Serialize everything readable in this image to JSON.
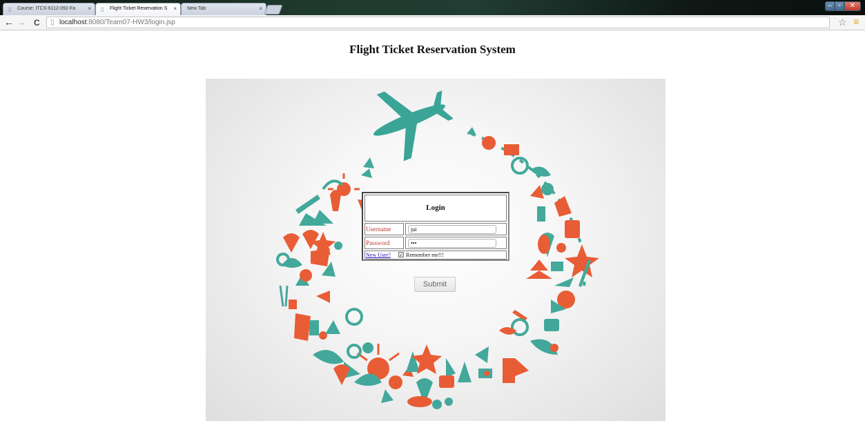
{
  "browser": {
    "tabs": [
      {
        "label": "Course: ITCS-6112-092-Fa",
        "active": false
      },
      {
        "label": "Flight Ticket Reservation S",
        "active": true
      },
      {
        "label": "New Tab",
        "active": false
      }
    ],
    "address": {
      "host": "localhost",
      "path": ":8080/Team07-HW3/login.jsp"
    }
  },
  "page": {
    "title": "Flight Ticket Reservation System"
  },
  "login": {
    "heading": "Login",
    "username_label": "Username",
    "username_value": "jui",
    "password_label": "Password",
    "password_value": "jui",
    "new_user_link": "New User?",
    "remember_checked": true,
    "remember_label": "Remember me!!!",
    "submit_label": "Submit"
  },
  "colors": {
    "teal": "#3aa597",
    "orange": "#e8552c",
    "label_red": "#c0392b",
    "link_blue": "#1a0dab"
  }
}
